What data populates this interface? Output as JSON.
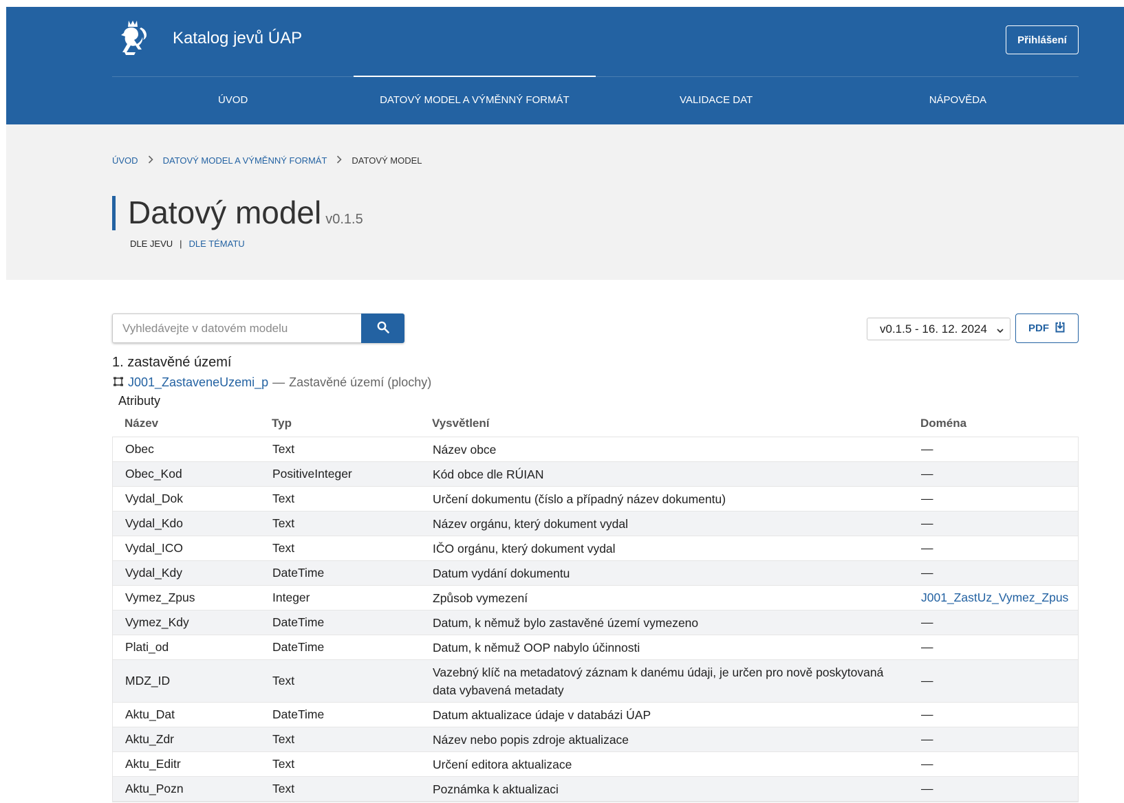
{
  "header": {
    "app_title": "Katalog jevů ÚAP",
    "login_label": "Přihlášení",
    "nav": [
      {
        "label": "ÚVOD"
      },
      {
        "label": "DATOVÝ MODEL A VÝMĚNNÝ FORMÁT"
      },
      {
        "label": "VALIDACE DAT"
      },
      {
        "label": "NÁPOVĚDA"
      }
    ],
    "active_nav_index": 1
  },
  "breadcrumb": {
    "items": [
      "ÚVOD",
      "DATOVÝ MODEL A VÝMĚNNÝ FORMÁT"
    ],
    "current": "DATOVÝ MODEL"
  },
  "page": {
    "title": "Datový model",
    "version": "v0.1.5",
    "view_active": "DLE JEVU",
    "view_separator": "|",
    "view_link": "DLE TÉMATU"
  },
  "toolbar": {
    "search_placeholder": "Vyhledávejte v datovém modelu",
    "search_value": "",
    "version_selected": "v0.1.5 - 16. 12. 2024",
    "pdf_label": "PDF"
  },
  "section": {
    "title": "1. zastavěné území",
    "feature_code": "J001_ZastaveneUzemi_p",
    "feature_separator": "—",
    "feature_desc": "Zastavěné území (plochy)",
    "attributes_label": "Atributy"
  },
  "table": {
    "headers": [
      "Název",
      "Typ",
      "Vysvětlení",
      "Doména"
    ],
    "rows": [
      [
        "Obec",
        "Text",
        "Název obce",
        "—"
      ],
      [
        "Obec_Kod",
        "PositiveInteger",
        "Kód obce dle RÚIAN",
        "—"
      ],
      [
        "Vydal_Dok",
        "Text",
        "Určení dokumentu (číslo a případný název dokumentu)",
        "—"
      ],
      [
        "Vydal_Kdo",
        "Text",
        "Název orgánu, který dokument vydal",
        "—"
      ],
      [
        "Vydal_ICO",
        "Text",
        "IČO orgánu, který dokument vydal",
        "—"
      ],
      [
        "Vydal_Kdy",
        "DateTime",
        "Datum vydání dokumentu",
        "—"
      ],
      [
        "Vymez_Zpus",
        "Integer",
        "Způsob vymezení",
        "J001_ZastUz_Vymez_Zpus"
      ],
      [
        "Vymez_Kdy",
        "DateTime",
        "Datum, k němuž bylo zastavěné území vymezeno",
        "—"
      ],
      [
        "Plati_od",
        "DateTime",
        "Datum, k němuž OOP nabylo účinnosti",
        "—"
      ],
      [
        "MDZ_ID",
        "Text",
        "Vazebný klíč na metadatový záznam k danému údaji, je určen pro nově poskytovaná data vybavená metadaty",
        "—"
      ],
      [
        "Aktu_Dat",
        "DateTime",
        "Datum aktualizace údaje v databázi ÚAP",
        "—"
      ],
      [
        "Aktu_Zdr",
        "Text",
        "Název nebo popis zdroje aktualizace",
        "—"
      ],
      [
        "Aktu_Editr",
        "Text",
        "Určení editora aktualizace",
        "—"
      ],
      [
        "Aktu_Pozn",
        "Text",
        "Poznámka k aktualizaci",
        "—"
      ]
    ],
    "linked_domains": [
      "J001_ZastUz_Vymez_Zpus"
    ],
    "tall_rows": [
      "MDZ_ID"
    ]
  },
  "icons": {
    "logo": "czech-lion-emblem-icon",
    "search": "search-icon",
    "select": "chevron-down-icon",
    "pdf": "download-icon",
    "feature": "polygon-icon",
    "breadcrumb_separator": "chevron-right-icon"
  },
  "colors": {
    "brand": "#2362a2",
    "band": "#f2f2f2",
    "row_alt": "#f2f3f5"
  }
}
